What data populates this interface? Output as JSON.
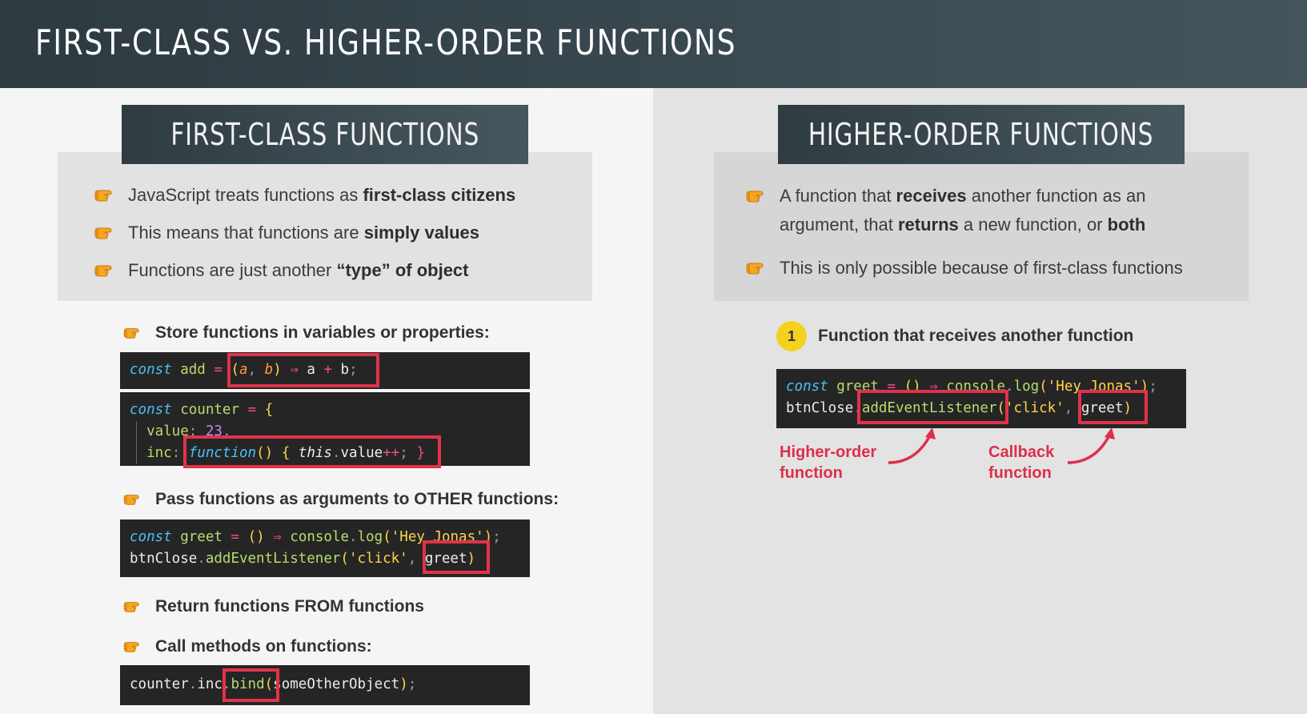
{
  "title": "FIRST-CLASS VS. HIGHER-ORDER FUNCTIONS",
  "left": {
    "heading": "FIRST-CLASS FUNCTIONS",
    "bullets": [
      {
        "pre": "JavaScript treats functions as ",
        "bold": "first-class citizens",
        "post": ""
      },
      {
        "pre": "This means that functions are ",
        "bold": "simply values",
        "post": ""
      },
      {
        "pre": "Functions are just another ",
        "bold": "“type” of object",
        "post": ""
      }
    ],
    "sub_items": [
      "Store functions in variables or properties:",
      "Pass functions as arguments to OTHER functions:",
      "Return functions FROM functions",
      "Call methods on functions:"
    ]
  },
  "right": {
    "heading": "HIGHER-ORDER FUNCTIONS",
    "bullet1": {
      "pre": "A function that ",
      "b1": "receives",
      "mid1": " another function as an",
      "mid2": "argument, that ",
      "b2": "returns",
      "mid3": " a new function, or ",
      "b3": "both"
    },
    "bullet2": "This is only possible because of first-class functions",
    "step_number": "1",
    "step_label": "Function that receives another function",
    "annotations": {
      "higher_order": [
        "Higher-order",
        "function"
      ],
      "callback": [
        "Callback",
        "function"
      ]
    }
  },
  "colors": {
    "highlight": "#e0334a",
    "badge": "#f3d11f",
    "code_bg": "#252526",
    "header_bg": "#2d3a40"
  },
  "icons": {
    "bullet": "pointing-hand-icon"
  }
}
